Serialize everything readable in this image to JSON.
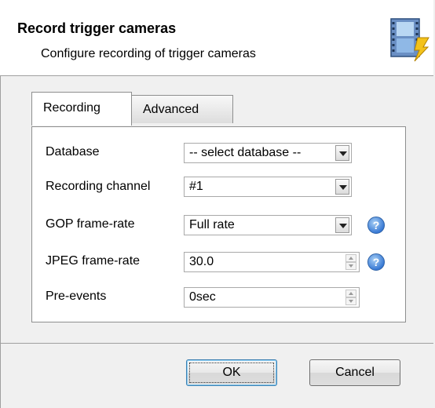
{
  "header": {
    "title": "Record trigger cameras",
    "subtitle": "Configure recording of trigger cameras",
    "icon": "film-lightning-icon"
  },
  "tabs": [
    {
      "label": "Recording",
      "active": true
    },
    {
      "label": "Advanced",
      "active": false
    }
  ],
  "form": {
    "database": {
      "label": "Database",
      "value": "-- select database --"
    },
    "recording_channel": {
      "label": "Recording channel",
      "value": "#1"
    },
    "gop_frame_rate": {
      "label": "GOP frame-rate",
      "value": "Full rate"
    },
    "jpeg_frame_rate": {
      "label": "JPEG frame-rate",
      "value": "30.0"
    },
    "pre_events": {
      "label": "Pre-events",
      "value": "0sec"
    }
  },
  "help_glyph": "?",
  "buttons": {
    "ok": "OK",
    "cancel": "Cancel"
  }
}
